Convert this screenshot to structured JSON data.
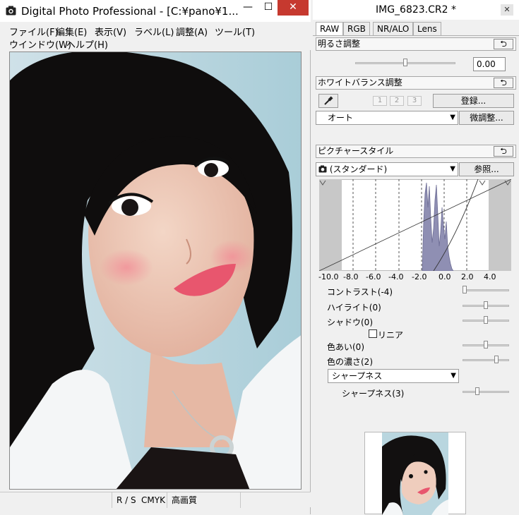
{
  "left_window": {
    "title": "Digital Photo Professional - [C:¥pano¥1...",
    "controls": {
      "minimize": "—",
      "maximize": "☐",
      "close": "✕"
    },
    "menu_row1": [
      "ファイル(F)",
      "編集(E)",
      "表示(V)",
      "ラベル(L)",
      "調整(A)",
      "ツール(T)"
    ],
    "menu_row2": [
      "ウインドウ(W)",
      "ヘルプ(H)"
    ],
    "status": {
      "cell1": "",
      "cell2": "R / S",
      "cell3": "CMYK",
      "cell4": "高画質",
      "cell5": ""
    }
  },
  "palette": {
    "title": "IMG_6823.CR2 *",
    "close": "✕",
    "tabs": [
      "RAW",
      "RGB",
      "NR/ALO",
      "Lens"
    ],
    "active_tab": "RAW",
    "brightness": {
      "header": "明るさ調整",
      "value": "0.00",
      "level": 0.5
    },
    "white_balance": {
      "header": "ホワイトバランス調整",
      "slots": [
        "1",
        "2",
        "3"
      ],
      "register_button": "登録...",
      "mode": "オート",
      "fine_tune_button": "微調整..."
    },
    "picture_style": {
      "header": "ピクチャースタイル",
      "style": "(スタンダード)",
      "browse_button": "参照...",
      "axis_ticks": [
        "-10.0",
        "-8.0",
        "-6.0",
        "-4.0",
        "-2.0",
        "0.0",
        "2.0",
        "4.0"
      ],
      "sliders": [
        {
          "label": "コントラスト(-4)",
          "level": 0.0
        },
        {
          "label": "ハイライト(0)",
          "level": 0.5
        },
        {
          "label": "シャドウ(0)",
          "level": 0.5
        },
        {
          "label": "色あい(0)",
          "level": 0.5
        },
        {
          "label": "色の濃さ(2)",
          "level": 0.75
        }
      ],
      "linear_checkbox": {
        "label": "リニア",
        "checked": false
      },
      "sharpness_mode": "シャープネス",
      "sharpness": {
        "label": "シャープネス(3)",
        "level": 0.3
      }
    }
  },
  "icons": {
    "app": "camera-icon",
    "eyedropper": "eyedropper-icon",
    "reset": "reset-arrow-icon",
    "style": "camera-icon"
  },
  "colors": {
    "close_red": "#c6392f",
    "histogram": "#8f8fb3"
  }
}
